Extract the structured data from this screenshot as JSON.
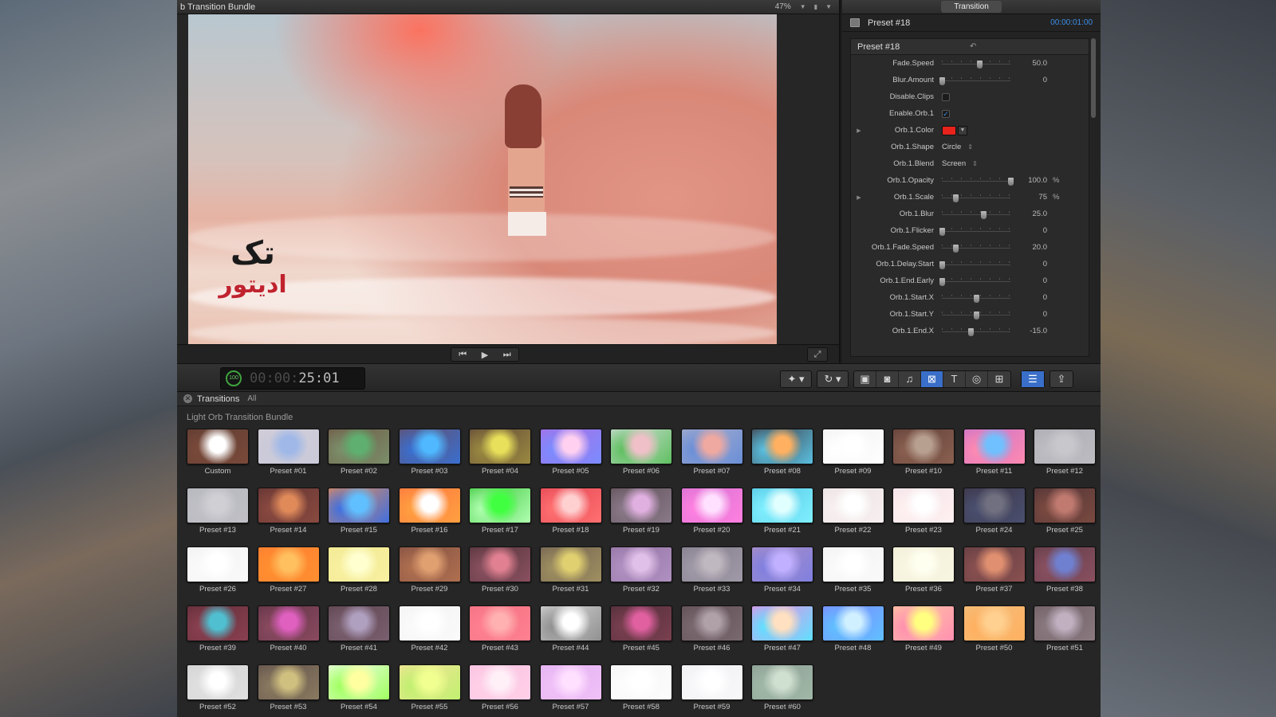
{
  "viewer": {
    "title": "b Transition Bundle",
    "zoom": "47%",
    "watermark_line1": "تک",
    "watermark_line2": "ادیتور"
  },
  "inspector": {
    "tab": "Transition",
    "header_name": "Preset #18",
    "header_timecode": "00:00:01:00",
    "panel_title": "Preset #18",
    "params": [
      {
        "label": "Fade.Speed",
        "type": "slider",
        "level": 0.55,
        "value": "50.0",
        "unit": ""
      },
      {
        "label": "Blur.Amount",
        "type": "slider",
        "level": 0.0,
        "value": "0",
        "unit": ""
      },
      {
        "label": "Disable.Clips",
        "type": "checkbox",
        "checked": false
      },
      {
        "label": "Enable.Orb.1",
        "type": "checkbox",
        "checked": true
      },
      {
        "label": "Orb.1.Color",
        "type": "color",
        "color": "#e8231b",
        "disclosure": true
      },
      {
        "label": "Orb.1.Shape",
        "type": "popup",
        "value": "Circle"
      },
      {
        "label": "Orb.1.Blend",
        "type": "popup",
        "value": "Screen"
      },
      {
        "label": "Orb.1.Opacity",
        "type": "slider",
        "level": 1.0,
        "value": "100.0",
        "unit": "%"
      },
      {
        "label": "Orb.1.Scale",
        "type": "slider",
        "level": 0.2,
        "value": "75",
        "unit": "%",
        "disclosure": true
      },
      {
        "label": "Orb.1.Blur",
        "type": "slider",
        "level": 0.6,
        "value": "25.0",
        "unit": ""
      },
      {
        "label": "Orb.1.Flicker",
        "type": "slider",
        "level": 0.0,
        "value": "0",
        "unit": ""
      },
      {
        "label": "Orb.1.Fade.Speed",
        "type": "slider",
        "level": 0.2,
        "value": "20.0",
        "unit": ""
      },
      {
        "label": "Orb.1.Delay.Start",
        "type": "slider",
        "level": 0.0,
        "value": "0",
        "unit": ""
      },
      {
        "label": "Orb.1.End.Early",
        "type": "slider",
        "level": 0.0,
        "value": "0",
        "unit": ""
      },
      {
        "label": "Orb.1.Start.X",
        "type": "slider",
        "level": 0.5,
        "value": "0",
        "unit": ""
      },
      {
        "label": "Orb.1.Start.Y",
        "type": "slider",
        "level": 0.5,
        "value": "0",
        "unit": ""
      },
      {
        "label": "Orb.1.End.X",
        "type": "slider",
        "level": 0.42,
        "value": "-15.0",
        "unit": ""
      }
    ]
  },
  "toolbar": {
    "badge": "100",
    "timecode_dim": "00:00:",
    "timecode": "25:01"
  },
  "browser": {
    "title": "Transitions",
    "filter": "All",
    "group_title": "Light Orb Transition Bundle",
    "presets": [
      {
        "label": "Custom",
        "colors": [
          "#ffffff",
          "#7a4a3a",
          "#5a3a30"
        ]
      },
      {
        "label": "Preset #01",
        "colors": [
          "#9fb8e8",
          "#c9c9d9",
          "#d5cfd8"
        ]
      },
      {
        "label": "Preset #02",
        "colors": [
          "#5fb070",
          "#7b8f6a",
          "#6d4f40"
        ]
      },
      {
        "label": "Preset #03",
        "colors": [
          "#4fb8ff",
          "#3a6fd0",
          "#6b4a58"
        ]
      },
      {
        "label": "Preset #04",
        "colors": [
          "#e8e05a",
          "#9a8a40",
          "#5a3e38"
        ]
      },
      {
        "label": "Preset #05",
        "colors": [
          "#ffd0f0",
          "#7a8cff",
          "#b06ae0"
        ]
      },
      {
        "label": "Preset #06",
        "colors": [
          "#f0c0c8",
          "#5fc060",
          "#e0e0e8"
        ]
      },
      {
        "label": "Preset #07",
        "colors": [
          "#f0a9a0",
          "#6a8fd8",
          "#b0b0c8"
        ]
      },
      {
        "label": "Preset #08",
        "colors": [
          "#ffb060",
          "#5ac0e0",
          "#3a2a30"
        ]
      },
      {
        "label": "Preset #09",
        "colors": [
          "#ffffff",
          "#ffffff",
          "#f0eeee"
        ]
      },
      {
        "label": "Preset #10",
        "colors": [
          "#b8a090",
          "#8a6050",
          "#5a3a35"
        ]
      },
      {
        "label": "Preset #11",
        "colors": [
          "#70c0ff",
          "#ff8ab0",
          "#c070d0"
        ]
      },
      {
        "label": "Preset #12",
        "colors": [
          "#c8c8cc",
          "#bdbdc2",
          "#a8a8b0"
        ]
      },
      {
        "label": "Preset #13",
        "colors": [
          "#d0d0d4",
          "#c0c0c6",
          "#b4b4bc"
        ]
      },
      {
        "label": "Preset #14",
        "colors": [
          "#e08a5a",
          "#8a4a40",
          "#5a3030"
        ]
      },
      {
        "label": "Preset #15",
        "colors": [
          "#60c0ff",
          "#4070e0",
          "#ff9040"
        ]
      },
      {
        "label": "Preset #16",
        "colors": [
          "#ffffff",
          "#ffa040",
          "#ff7040"
        ]
      },
      {
        "label": "Preset #17",
        "colors": [
          "#40ff40",
          "#b0ffb0",
          "#30c030"
        ]
      },
      {
        "label": "Preset #18",
        "colors": [
          "#ffd0d0",
          "#ff7070",
          "#e04050"
        ]
      },
      {
        "label": "Preset #19",
        "colors": [
          "#e0b0e0",
          "#8a7a8a",
          "#5a4a50"
        ]
      },
      {
        "label": "Preset #20",
        "colors": [
          "#ffe0ff",
          "#ff80e0",
          "#d070d0"
        ]
      },
      {
        "label": "Preset #21",
        "colors": [
          "#e0ffff",
          "#80f0ff",
          "#50c0e0"
        ]
      },
      {
        "label": "Preset #22",
        "colors": [
          "#ffffff",
          "#f8f0f0",
          "#e8e0e0"
        ]
      },
      {
        "label": "Preset #23",
        "colors": [
          "#ffffff",
          "#fff0f0",
          "#f0e0e8"
        ]
      },
      {
        "label": "Preset #24",
        "colors": [
          "#707080",
          "#4a5070",
          "#3a3040"
        ]
      },
      {
        "label": "Preset #25",
        "colors": [
          "#c07a70",
          "#7a4a40",
          "#4a3035"
        ]
      },
      {
        "label": "Preset #26",
        "colors": [
          "#ffffff",
          "#fafafa",
          "#f0f0f0"
        ]
      },
      {
        "label": "Preset #27",
        "colors": [
          "#ffc060",
          "#ff9030",
          "#ff7a30"
        ]
      },
      {
        "label": "Preset #28",
        "colors": [
          "#ffffd0",
          "#f8f0a0",
          "#f0e890"
        ]
      },
      {
        "label": "Preset #29",
        "colors": [
          "#e0a070",
          "#b07050",
          "#7a4a40"
        ]
      },
      {
        "label": "Preset #30",
        "colors": [
          "#e08090",
          "#8a5060",
          "#4a3035"
        ]
      },
      {
        "label": "Preset #31",
        "colors": [
          "#e0d070",
          "#a09060",
          "#6a5a50"
        ]
      },
      {
        "label": "Preset #32",
        "colors": [
          "#e0c0e8",
          "#b090c0",
          "#9070a0"
        ]
      },
      {
        "label": "Preset #33",
        "colors": [
          "#c0b8c0",
          "#a09aa8",
          "#807a88"
        ]
      },
      {
        "label": "Preset #34",
        "colors": [
          "#c0b0ff",
          "#8080e0",
          "#b090c0"
        ]
      },
      {
        "label": "Preset #35",
        "colors": [
          "#ffffff",
          "#fafafa",
          "#f0f0f0"
        ]
      },
      {
        "label": "Preset #36",
        "colors": [
          "#fffff0",
          "#f8f6e0",
          "#f0ecd8"
        ]
      },
      {
        "label": "Preset #37",
        "colors": [
          "#e09070",
          "#8a5050",
          "#5a3a40"
        ]
      },
      {
        "label": "Preset #38",
        "colors": [
          "#7080d0",
          "#8a5060",
          "#5a3a45"
        ]
      },
      {
        "label": "Preset #39",
        "colors": [
          "#50c0d0",
          "#8a4050",
          "#5a2a35"
        ]
      },
      {
        "label": "Preset #40",
        "colors": [
          "#e060c0",
          "#8a4a60",
          "#5a3040"
        ]
      },
      {
        "label": "Preset #41",
        "colors": [
          "#b0a0c0",
          "#7a6070",
          "#5a4048"
        ]
      },
      {
        "label": "Preset #42",
        "colors": [
          "#ffffff",
          "#fafafa",
          "#f2f2f2"
        ]
      },
      {
        "label": "Preset #43",
        "colors": [
          "#ffb0b0",
          "#ff8090",
          "#f07080"
        ]
      },
      {
        "label": "Preset #44",
        "colors": [
          "#ffffff",
          "#909090",
          "#e0e0e0"
        ]
      },
      {
        "label": "Preset #45",
        "colors": [
          "#e060a0",
          "#7a4050",
          "#4a2a35"
        ]
      },
      {
        "label": "Preset #46",
        "colors": [
          "#b0a0a8",
          "#7a6a70",
          "#5a4a50"
        ]
      },
      {
        "label": "Preset #47",
        "colors": [
          "#ffe0c0",
          "#60e0ff",
          "#ff80e0"
        ]
      },
      {
        "label": "Preset #48",
        "colors": [
          "#d0f0ff",
          "#60c0ff",
          "#8080ff"
        ]
      },
      {
        "label": "Preset #49",
        "colors": [
          "#ffff80",
          "#ff90b0",
          "#ffd0a0"
        ]
      },
      {
        "label": "Preset #50",
        "colors": [
          "#ffd090",
          "#ffb060",
          "#f0c080"
        ]
      },
      {
        "label": "Preset #51",
        "colors": [
          "#c0b0c0",
          "#8a7a80",
          "#6a5a60"
        ]
      },
      {
        "label": "Preset #52",
        "colors": [
          "#ffffff",
          "#e0e0e0",
          "#d0d0d0"
        ]
      },
      {
        "label": "Preset #53",
        "colors": [
          "#d0c080",
          "#8a7a60",
          "#5a4a48"
        ]
      },
      {
        "label": "Preset #54",
        "colors": [
          "#ffffa0",
          "#a0ff60",
          "#ffffff"
        ]
      },
      {
        "label": "Preset #55",
        "colors": [
          "#f0ff90",
          "#c0f070",
          "#ffe0a0"
        ]
      },
      {
        "label": "Preset #56",
        "colors": [
          "#fff0f8",
          "#ffd0e8",
          "#f8c0e0"
        ]
      },
      {
        "label": "Preset #57",
        "colors": [
          "#ffe0ff",
          "#f0c0f8",
          "#e0b0f0"
        ]
      },
      {
        "label": "Preset #58",
        "colors": [
          "#ffffff",
          "#fcfcfc",
          "#f4f4f4"
        ]
      },
      {
        "label": "Preset #59",
        "colors": [
          "#ffffff",
          "#f8f8fa",
          "#eeeef2"
        ]
      },
      {
        "label": "Preset #60",
        "colors": [
          "#d0e0d0",
          "#a0b8a8",
          "#8a9a90"
        ]
      }
    ]
  }
}
